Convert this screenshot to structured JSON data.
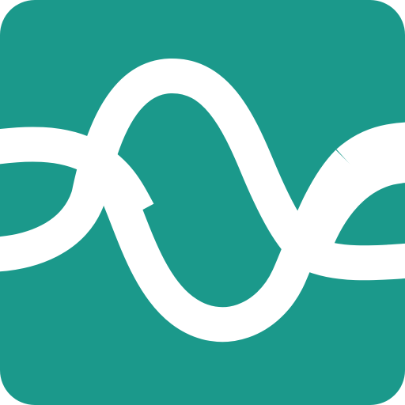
{
  "icon": {
    "name": "wave-knot-icon",
    "colors": {
      "background": "#1B998B",
      "stroke": "#FFFFFF"
    }
  }
}
